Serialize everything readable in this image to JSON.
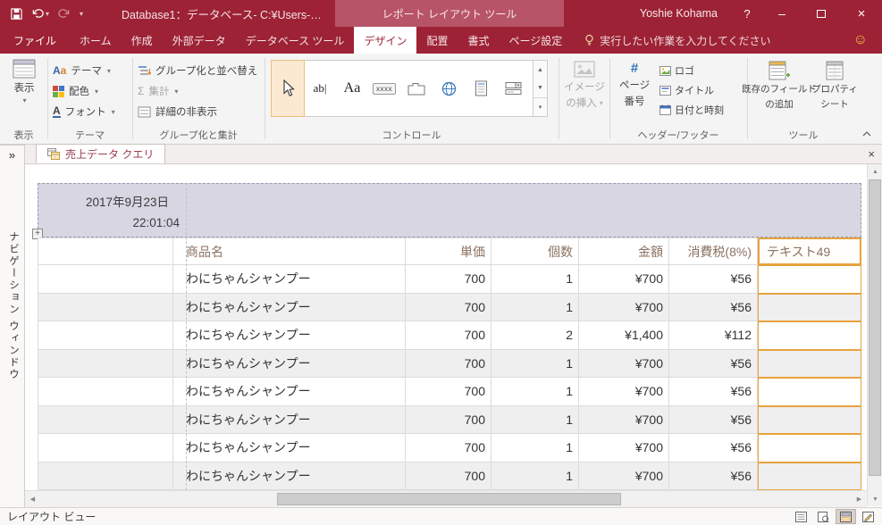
{
  "titlebar": {
    "title": "Database1：データベース- C:¥Users-…",
    "contextual_title": "レポート レイアウト ツール",
    "user": "Yoshie Kohama",
    "help": "?",
    "minimize": "–",
    "close": "×"
  },
  "ribbon_tabs": {
    "file": "ファイル",
    "home": "ホーム",
    "create": "作成",
    "external": "外部データ",
    "dbtools": "データベース ツール",
    "design": "デザイン",
    "arrange": "配置",
    "format": "書式",
    "page": "ページ設定",
    "tellme": "実行したい作業を入力してください"
  },
  "ribbon": {
    "view": {
      "button": "表示",
      "group": "表示"
    },
    "themes": {
      "theme": "テーマ",
      "colors": "配色",
      "fonts": "フォント",
      "group": "テーマ"
    },
    "grouping": {
      "sort": "グループ化と並べ替え",
      "totals": "集計",
      "hide": "詳細の非表示",
      "group": "グループ化と集計"
    },
    "controls": {
      "ab": "ab|",
      "aa": "Aa",
      "xxxx": "xxxx",
      "group": "コントロール"
    },
    "image": {
      "line1": "イメージ",
      "line2": "の挿入"
    },
    "headerfooter": {
      "page1": "ページ",
      "page2": "番号",
      "logo": "ロゴ",
      "title": "タイトル",
      "datetime": "日付と時刻",
      "group": "ヘッダー/フッター"
    },
    "tools": {
      "fields1": "既存のフィールド",
      "fields2": "の追加",
      "props1": "プロパティ",
      "props2": "シート",
      "group": "ツール"
    }
  },
  "document": {
    "tab_title": "売上データ クエリ"
  },
  "navpane": {
    "title": "ナビゲーション ウィンドウ",
    "expand": "»"
  },
  "report": {
    "date": "2017年9月23日",
    "time": "22:01:04",
    "columns": [
      "商品名",
      "単価",
      "個数",
      "金額",
      "消費税(8%)",
      "テキスト49"
    ],
    "rows": [
      {
        "product": "わにちゃんシャンプー",
        "price": "700",
        "qty": "1",
        "amount": "¥700",
        "tax": "¥56"
      },
      {
        "product": "わにちゃんシャンプー",
        "price": "700",
        "qty": "1",
        "amount": "¥700",
        "tax": "¥56"
      },
      {
        "product": "わにちゃんシャンプー",
        "price": "700",
        "qty": "2",
        "amount": "¥1,400",
        "tax": "¥112"
      },
      {
        "product": "わにちゃんシャンプー",
        "price": "700",
        "qty": "1",
        "amount": "¥700",
        "tax": "¥56"
      },
      {
        "product": "わにちゃんシャンプー",
        "price": "700",
        "qty": "1",
        "amount": "¥700",
        "tax": "¥56"
      },
      {
        "product": "わにちゃんシャンプー",
        "price": "700",
        "qty": "1",
        "amount": "¥700",
        "tax": "¥56"
      },
      {
        "product": "わにちゃんシャンプー",
        "price": "700",
        "qty": "1",
        "amount": "¥700",
        "tax": "¥56"
      },
      {
        "product": "わにちゃんシャンプー",
        "price": "700",
        "qty": "1",
        "amount": "¥700",
        "tax": "¥56"
      }
    ]
  },
  "statusbar": {
    "view_label": "レイアウト ビュー"
  },
  "icons": {
    "caret_down": "▾",
    "smiley": "☺",
    "chevron_double": "»",
    "close_small": "×",
    "up": "▲",
    "down": "▼",
    "left": "◀",
    "right": "▶",
    "sigma": "Σ",
    "hash": "#",
    "plus": "+"
  },
  "colors": {
    "accent": "#9D2235",
    "contextual": "#B85468",
    "selection": "#E7A33E",
    "header_band": "#D9D6E3"
  }
}
